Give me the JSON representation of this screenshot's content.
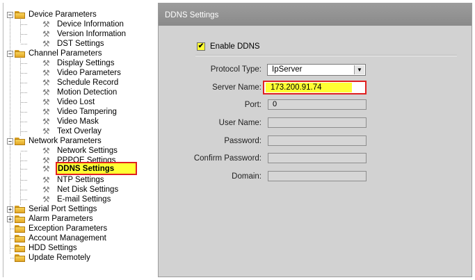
{
  "tree": {
    "device_parameters": "Device Parameters",
    "device_information": "Device Information",
    "version_information": "Version Information",
    "dst_settings": "DST Settings",
    "channel_parameters": "Channel Parameters",
    "display_settings": "Display Settings",
    "video_parameters": "Video Parameters",
    "schedule_record": "Schedule Record",
    "motion_detection": "Motion Detection",
    "video_lost": "Video Lost",
    "video_tampering": "Video Tampering",
    "video_mask": "Video Mask",
    "text_overlay": "Text Overlay",
    "network_parameters": "Network Parameters",
    "network_settings": "Network Settings",
    "pppoe_settings": "PPPOE Settings",
    "ddns_settings": "DDNS Settings",
    "ntp_settings": "NTP Settings",
    "net_disk_settings": "Net Disk Settings",
    "email_settings": "E-mail Settings",
    "serial_port_settings": "Serial Port Settings",
    "alarm_parameters": "Alarm Parameters",
    "exception_parameters": "Exception Parameters",
    "account_management": "Account Management",
    "hdd_settings": "HDD Settings",
    "update_remotely": "Update Remotely",
    "expand_collapsed": "+",
    "expand_open": "−"
  },
  "panel": {
    "title": "DDNS Settings",
    "enable_ddns_label": "Enable DDNS",
    "enable_ddns_checked": true,
    "enable_check_glyph": "✔",
    "protocol_type_label": "Protocol Type:",
    "protocol_type_value": "IpServer",
    "server_name_label": "Server Name:",
    "server_name_value": "173.200.91.74",
    "port_label": "Port:",
    "port_value": "0",
    "user_name_label": "User Name:",
    "user_name_value": "",
    "password_label": "Password:",
    "password_value": "",
    "confirm_password_label": "Confirm Password:",
    "confirm_password_value": "",
    "domain_label": "Domain:",
    "domain_value": ""
  },
  "icons": {
    "folder": "folder-icon",
    "leaf": "wrench-icon",
    "dropdown": "dropdown-arrow-icon",
    "checkmark": "checkmark-icon"
  },
  "colors": {
    "highlight": "#ffff33",
    "callout_border": "#e02020",
    "header_bg": "#969696",
    "panel_bg": "#d2d2d2"
  }
}
